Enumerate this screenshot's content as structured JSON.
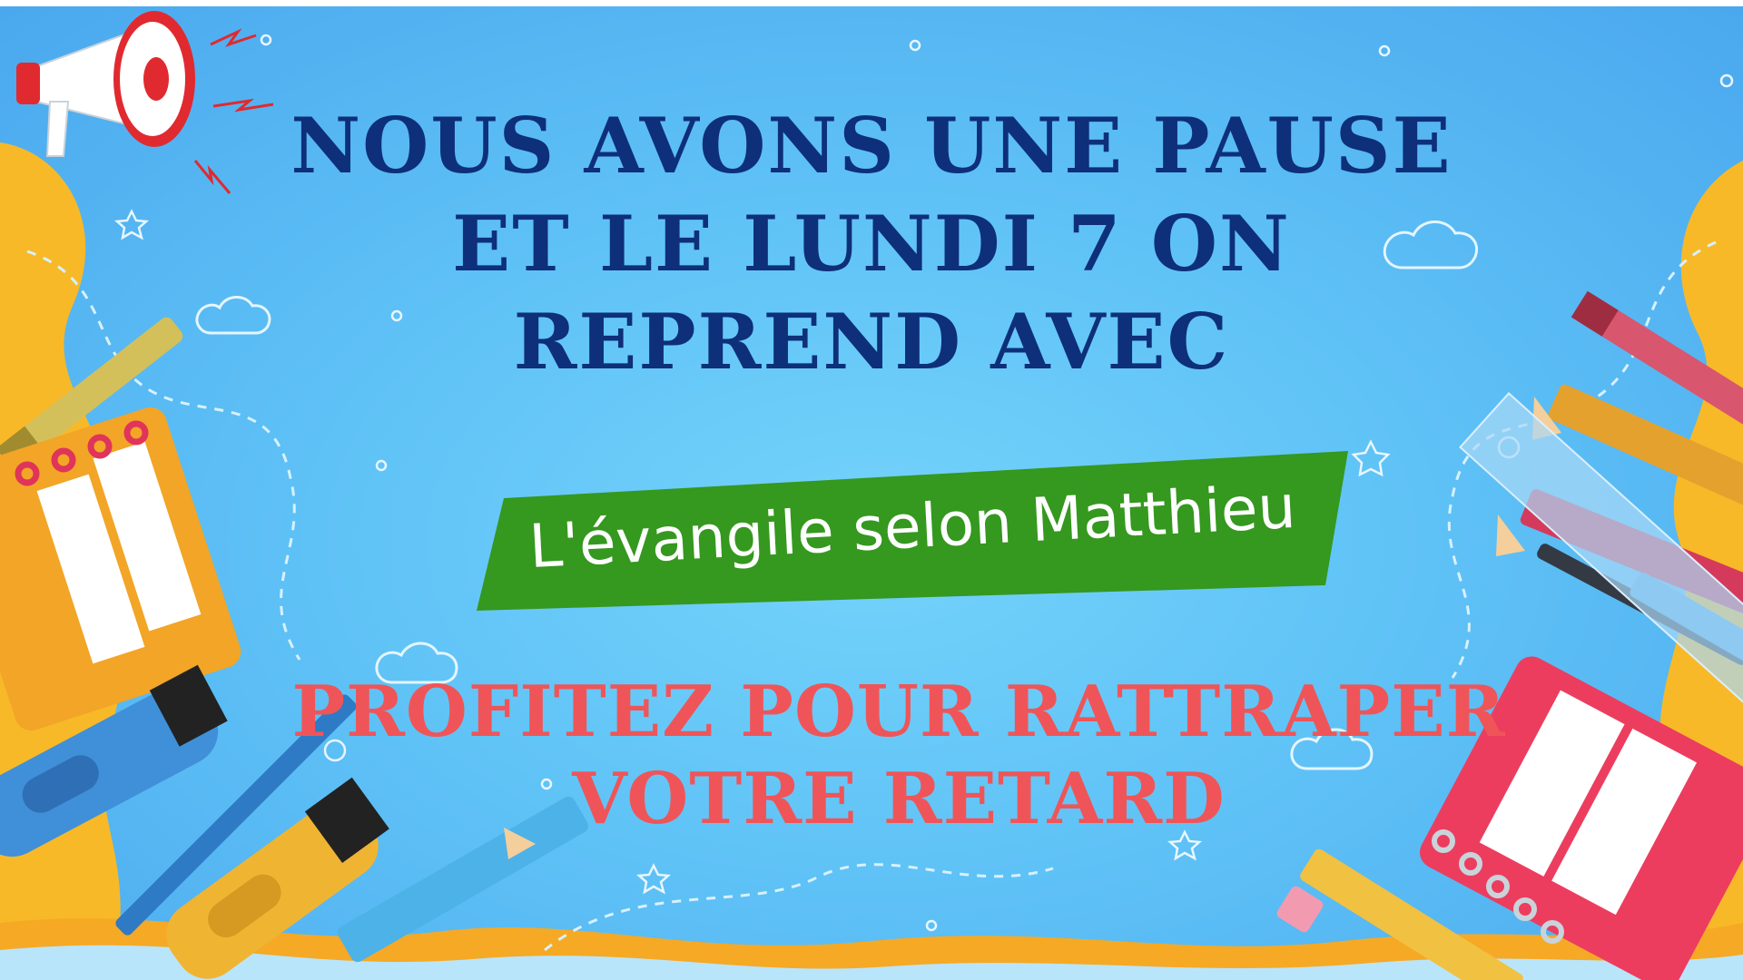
{
  "headline": {
    "line1": "Nous avons une pause",
    "line2": "et le lundi 7 on",
    "line3": "reprend avec"
  },
  "banner": {
    "text": "L'évangile selon Matthieu"
  },
  "callout": {
    "line1": "Profitez pour rattraper",
    "line2": "votre retard"
  },
  "colors": {
    "background": "#5fc2f6",
    "headline": "#0e2f7a",
    "banner": "#35981f",
    "callout": "#ef5558",
    "accent_yellow": "#f8b928"
  },
  "icons": [
    "megaphone-icon",
    "crayon-icon",
    "notebook-icon",
    "marker-icon",
    "pencil-icon",
    "ruler-icon",
    "cloud-icon",
    "star-icon"
  ]
}
